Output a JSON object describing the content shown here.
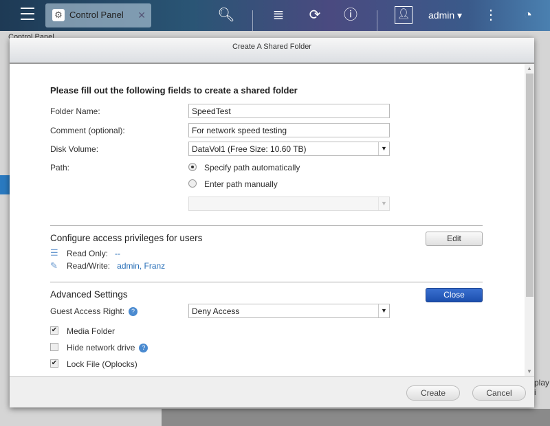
{
  "topbar": {
    "tab_label": "Control Panel",
    "user": "admin",
    "icons": [
      "menu-icon",
      "gear-icon",
      "close-icon",
      "search-icon",
      "stack-icon",
      "sync-icon",
      "info-icon",
      "user-icon",
      "more-icon",
      "dashboard-icon"
    ]
  },
  "background": {
    "panel_label": "Control Panel",
    "partial_text": "play i"
  },
  "dialog": {
    "title": "Create A Shared Folder",
    "section1_title": "Please fill out the following fields to create a shared folder",
    "folder_name_label": "Folder Name:",
    "folder_name": "SpeedTest",
    "comment_label": "Comment (optional):",
    "comment": "For network speed testing",
    "disk_volume_label": "Disk Volume:",
    "disk_volume": "DataVol1 (Free Size: 10.60 TB)",
    "path_label": "Path:",
    "path_auto": "Specify path automatically",
    "path_manual": "Enter path manually",
    "path_selected": "auto",
    "section2_title": "Configure access privileges for users",
    "edit_label": "Edit",
    "read_only_label": "Read Only:",
    "read_only_value": "--",
    "read_write_label": "Read/Write:",
    "read_write_value": "admin, Franz",
    "section3_title": "Advanced Settings",
    "close_label": "Close",
    "guest_label": "Guest Access Right:",
    "guest_value": "Deny Access",
    "options": [
      {
        "label": "Media Folder",
        "checked": true
      },
      {
        "label": "Hide network drive",
        "checked": false
      },
      {
        "label": "Lock File (Oplocks)",
        "checked": true
      }
    ],
    "create_label": "Create",
    "cancel_label": "Cancel"
  }
}
